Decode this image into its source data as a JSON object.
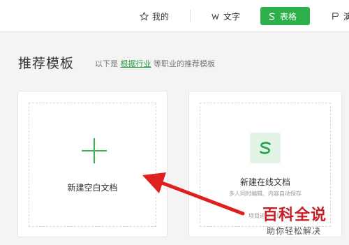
{
  "nav": {
    "items": [
      {
        "label": "我的",
        "icon": "star-icon"
      },
      {
        "label": "文字",
        "icon": "w-doc-icon"
      },
      {
        "label": "表格",
        "icon": "s-sheet-icon",
        "active": true
      },
      {
        "label": "演",
        "icon": "p-slides-icon"
      }
    ]
  },
  "section": {
    "title": "推荐模板",
    "subtitle_prefix": "以下是",
    "subtitle_link": "根据行业",
    "subtitle_suffix": "等职业的推荐模板"
  },
  "cards": {
    "blank": {
      "label": "新建空白文档",
      "icon": "plus-icon"
    },
    "online": {
      "label": "新建在线文档",
      "desc1": "多人同时编辑、内容自动保存",
      "desc2": "项目进度管理",
      "icon": "s-badge-icon"
    }
  },
  "watermark": {
    "logo": "百科全说",
    "sub": "助你轻松解决"
  },
  "colors": {
    "accent": "#2db04b",
    "arrow": "#e02020",
    "watermark": "#c81d24"
  }
}
